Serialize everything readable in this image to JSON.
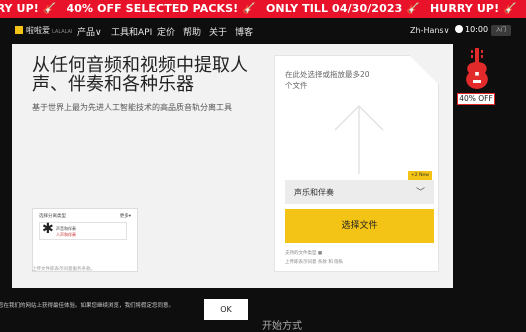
{
  "promo": {
    "items": [
      "RRY UP! 🎸",
      "40% OFF SELECTED PACKS! 🎸",
      "ONLY TILL 04/30/2023 🎸",
      "HURRY UP! 🎸"
    ]
  },
  "nav": {
    "brand": "啦啦爱",
    "brand_small": "LALALAI",
    "items": [
      "产品∨",
      "工具和API",
      "定价",
      "帮助",
      "关于",
      "博客"
    ],
    "lang": "Zh-Hans∨",
    "credit": "10:00",
    "login": "入门"
  },
  "hero": {
    "title": "从任何音频和视频中提取人声、伴奏和各种乐器",
    "subtitle": "基于世界上最为先进人工智能技术的高品质音轨分离工具",
    "thumb_title": "选择分离类型",
    "thumb_more": "更多▾",
    "thumb_line1": "声音和伴奏",
    "thumb_line2": "人声和伴奏",
    "thumb_caption": "上传文件即表示同意服务条款。"
  },
  "upload": {
    "drop_text": "在此处选择或拖放最多20个文件",
    "badge": "+2 New",
    "stem_value": "声乐和伴奏",
    "choose_label": "选择文件",
    "fine1": "支持的文件类型 ■",
    "fine2": "上传即表示同意 条款 和 隐私"
  },
  "sale": {
    "label": "40% OFF"
  },
  "cookie": {
    "text": "您在我们的网站上获得最佳体验。如果您继续浏览，我们将假定您同意。",
    "ok": "OK"
  },
  "bottom_text": "开始方式"
}
